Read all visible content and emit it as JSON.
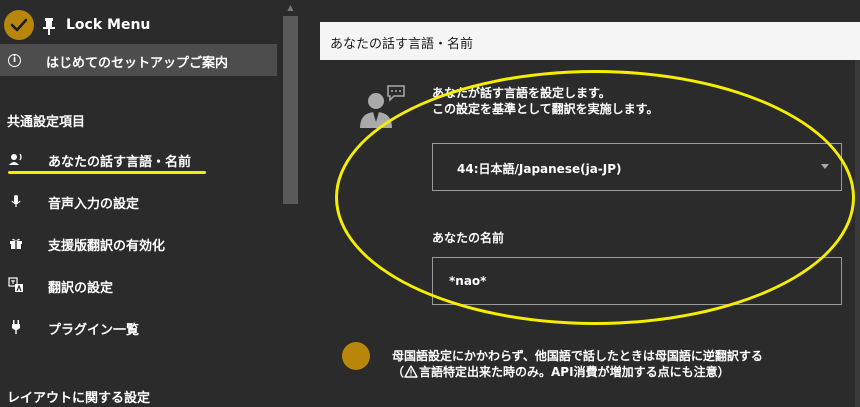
{
  "sidebar": {
    "lock_menu_label": "Lock Menu",
    "setup_label": "はじめてのセットアップご案内",
    "common_heading": "共通設定項目",
    "items": [
      {
        "label": "あなたの話す言語・名前",
        "icon": "speaking-person-icon"
      },
      {
        "label": "音声入力の設定",
        "icon": "microphone-icon"
      },
      {
        "label": "支援版翻訳の有効化",
        "icon": "gift-icon"
      },
      {
        "label": "翻訳の設定",
        "icon": "translate-icon"
      },
      {
        "label": "プラグイン一覧",
        "icon": "plug-icon"
      }
    ],
    "layout_heading": "レイアウトに関する設定"
  },
  "panel": {
    "title": "あなたの話す言語・名前",
    "desc_line1": "あなたが話す言語を設定します。",
    "desc_line2": "この設定を基準として翻訳を実施します。",
    "language_value": "44:日本語/Japanese(ja-JP)",
    "name_label": "あなたの名前",
    "name_value": "*nao*",
    "toggle_line1": "母国語設定にかかわらず、他国語で話したときは母国語に逆翻訳する",
    "toggle_line2_prefix": "（",
    "toggle_line2": "言語特定出来た時のみ。API消費が増加する点にも注意）"
  },
  "colors": {
    "accent": "#b8860b",
    "highlight": "#f5ee00",
    "background": "#2b2b2b",
    "header_bg": "#f5f5f5"
  }
}
